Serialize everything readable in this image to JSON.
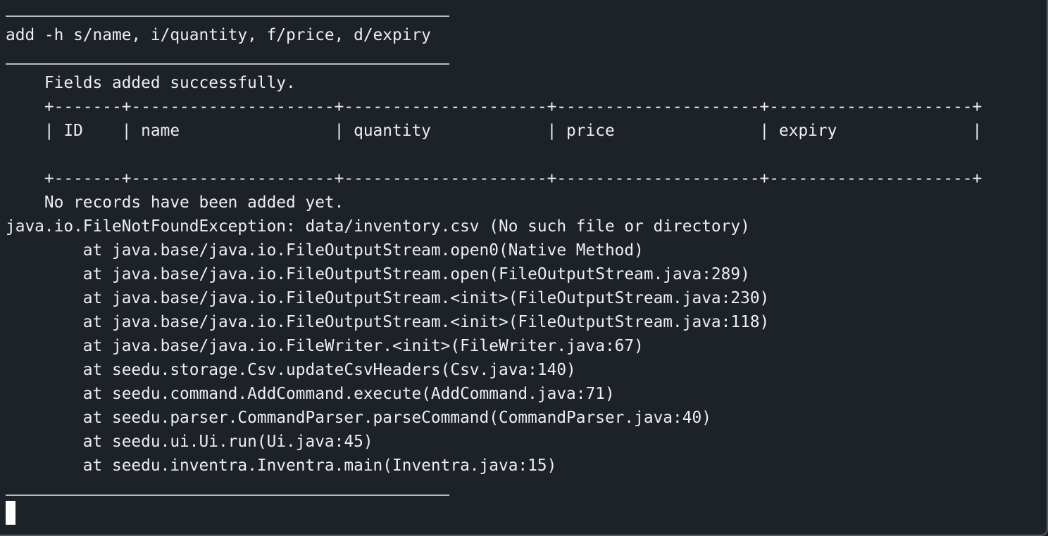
{
  "terminal": {
    "command": "add -h s/name, i/quantity, f/price, d/expiry",
    "success_message": "    Fields added successfully.",
    "table": {
      "border_top": "    +-------+---------------------+---------------------+---------------------+---------------------+",
      "header_row": "    | ID    | name                | quantity            | price               | expiry              |",
      "border_bottom": "    +-------+---------------------+---------------------+---------------------+---------------------+",
      "headers": [
        "ID",
        "name",
        "quantity",
        "price",
        "expiry"
      ]
    },
    "empty_message": "    No records have been added yet.",
    "exception": "java.io.FileNotFoundException: data/inventory.csv (No such file or directory)",
    "stack_trace": [
      "        at java.base/java.io.FileOutputStream.open0(Native Method)",
      "        at java.base/java.io.FileOutputStream.open(FileOutputStream.java:289)",
      "        at java.base/java.io.FileOutputStream.<init>(FileOutputStream.java:230)",
      "        at java.base/java.io.FileOutputStream.<init>(FileOutputStream.java:118)",
      "        at java.base/java.io.FileWriter.<init>(FileWriter.java:67)",
      "        at seedu.storage.Csv.updateCsvHeaders(Csv.java:140)",
      "        at seedu.command.AddCommand.execute(AddCommand.java:71)",
      "        at seedu.parser.CommandParser.parseCommand(CommandParser.java:40)",
      "        at seedu.ui.Ui.run(Ui.java:45)",
      "        at seedu.inventra.Inventra.main(Inventra.java:15)"
    ]
  },
  "colors": {
    "background": "#1d2128",
    "text": "#eceef0",
    "divider": "#b8bcc2",
    "cursor": "#ffffff"
  }
}
